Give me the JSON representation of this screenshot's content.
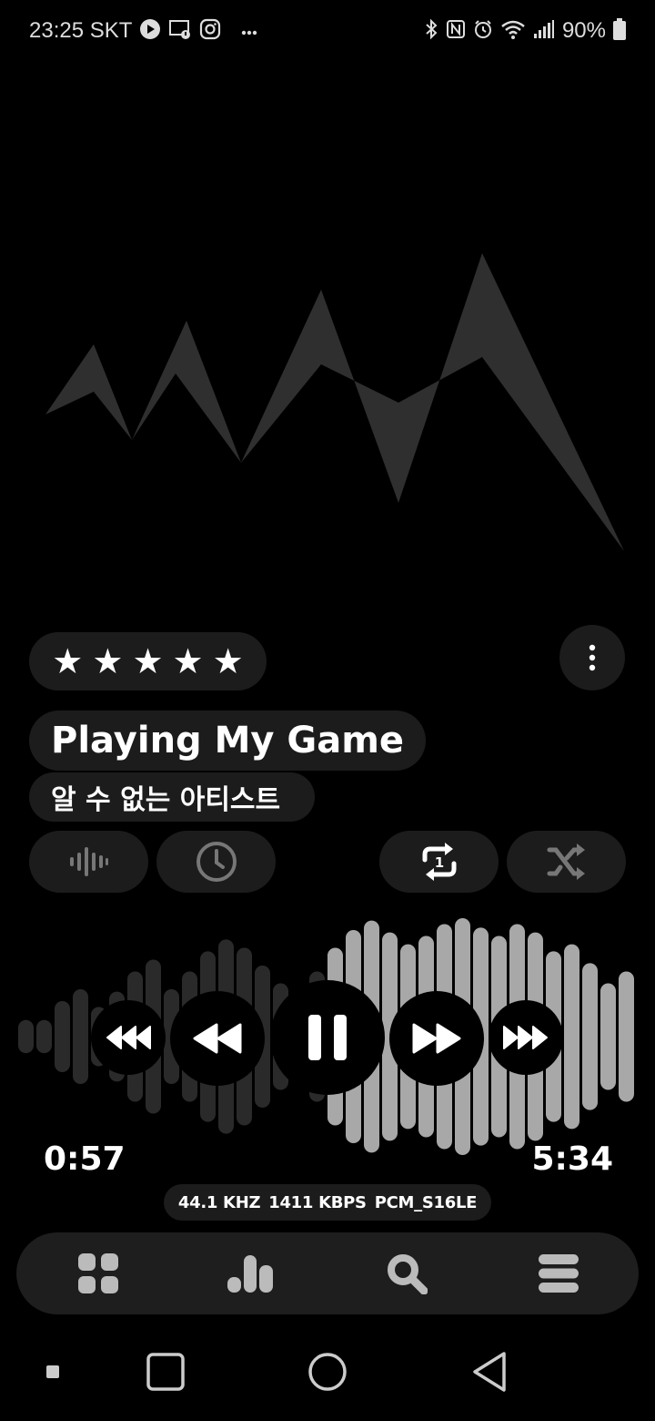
{
  "status_bar": {
    "time": "23:25",
    "carrier": "SKT",
    "battery": "90%",
    "left_icons": [
      "play-circle-icon",
      "cast-alert-icon",
      "instagram-icon",
      "more-dots-icon"
    ],
    "right_icons": [
      "bluetooth-icon",
      "nfc-icon",
      "alarm-icon",
      "wifi-icon",
      "signal-icon",
      "battery-icon"
    ]
  },
  "rating": {
    "stars": 5,
    "filled": 5,
    "star_glyph": "★"
  },
  "track": {
    "title": "Playing My Game",
    "artist": "알 수 없는 아티스트"
  },
  "actions": {
    "items": [
      "waveform-icon",
      "clock-icon",
      "repeat-one-icon",
      "shuffle-icon"
    ]
  },
  "playback": {
    "current_time": "0:57",
    "total_time": "5:34",
    "progress": 0.171
  },
  "audio_info": {
    "sample_rate": "44.1 KHZ",
    "bitrate": "1411 KBPS",
    "format": "PCM_S16LE"
  },
  "bottom_nav": {
    "items": [
      "grid-icon",
      "chart-icon",
      "search-icon",
      "menu-icon"
    ]
  },
  "system_nav": {
    "items": [
      "recents-small-icon",
      "square-icon",
      "home-circle-icon",
      "back-triangle-icon"
    ]
  },
  "colors": {
    "background": "#000000",
    "pill": "#1c1c1c",
    "wave_played": "#2a2a2a",
    "wave_unplayed": "#a8a8a8",
    "artwork": "#2f2f2f"
  }
}
